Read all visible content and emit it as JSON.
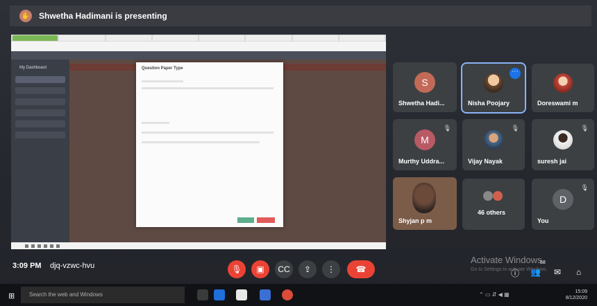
{
  "banner": {
    "text": "Shwetha Hadimani is presenting"
  },
  "shared_screen": {
    "sidebar_label": "My Dashboard",
    "modal_title": "Question Paper Type"
  },
  "participants": [
    {
      "name": "Shwetha Hadi...",
      "initial": "S",
      "color": "#c26a57"
    },
    {
      "name": "Nisha Poojary",
      "initial": "",
      "color": "#d38b3f",
      "selected": true
    },
    {
      "name": "Doreswami m",
      "initial": "",
      "color": "#c0483a"
    },
    {
      "name": "Murthy Uddra...",
      "initial": "M",
      "color": "#b85a64"
    },
    {
      "name": "Vijay Nayak",
      "initial": "",
      "color": "#4d6a8c"
    },
    {
      "name": "suresh jai",
      "initial": "",
      "color": "#e6e6e6"
    },
    {
      "name": "Shyjan p m",
      "initial": "",
      "color": "#444"
    },
    {
      "name": "46 others",
      "initial": "",
      "color": "#888"
    },
    {
      "name": "You",
      "initial": "D",
      "color": "#5f6368"
    }
  ],
  "meeting": {
    "time": "3:09 PM",
    "code": "djq-vzwc-hvu",
    "participant_count": "58"
  },
  "watermark": {
    "line1": "Activate Windows",
    "line2": "Go to Settings to activate Windows."
  },
  "taskbar": {
    "search": "Search the web and Windows",
    "time": "15:09",
    "date": "8/12/2020"
  },
  "colors": {
    "accent": "#1a73e8",
    "danger": "#ea4335",
    "tile": "#3c4043"
  }
}
